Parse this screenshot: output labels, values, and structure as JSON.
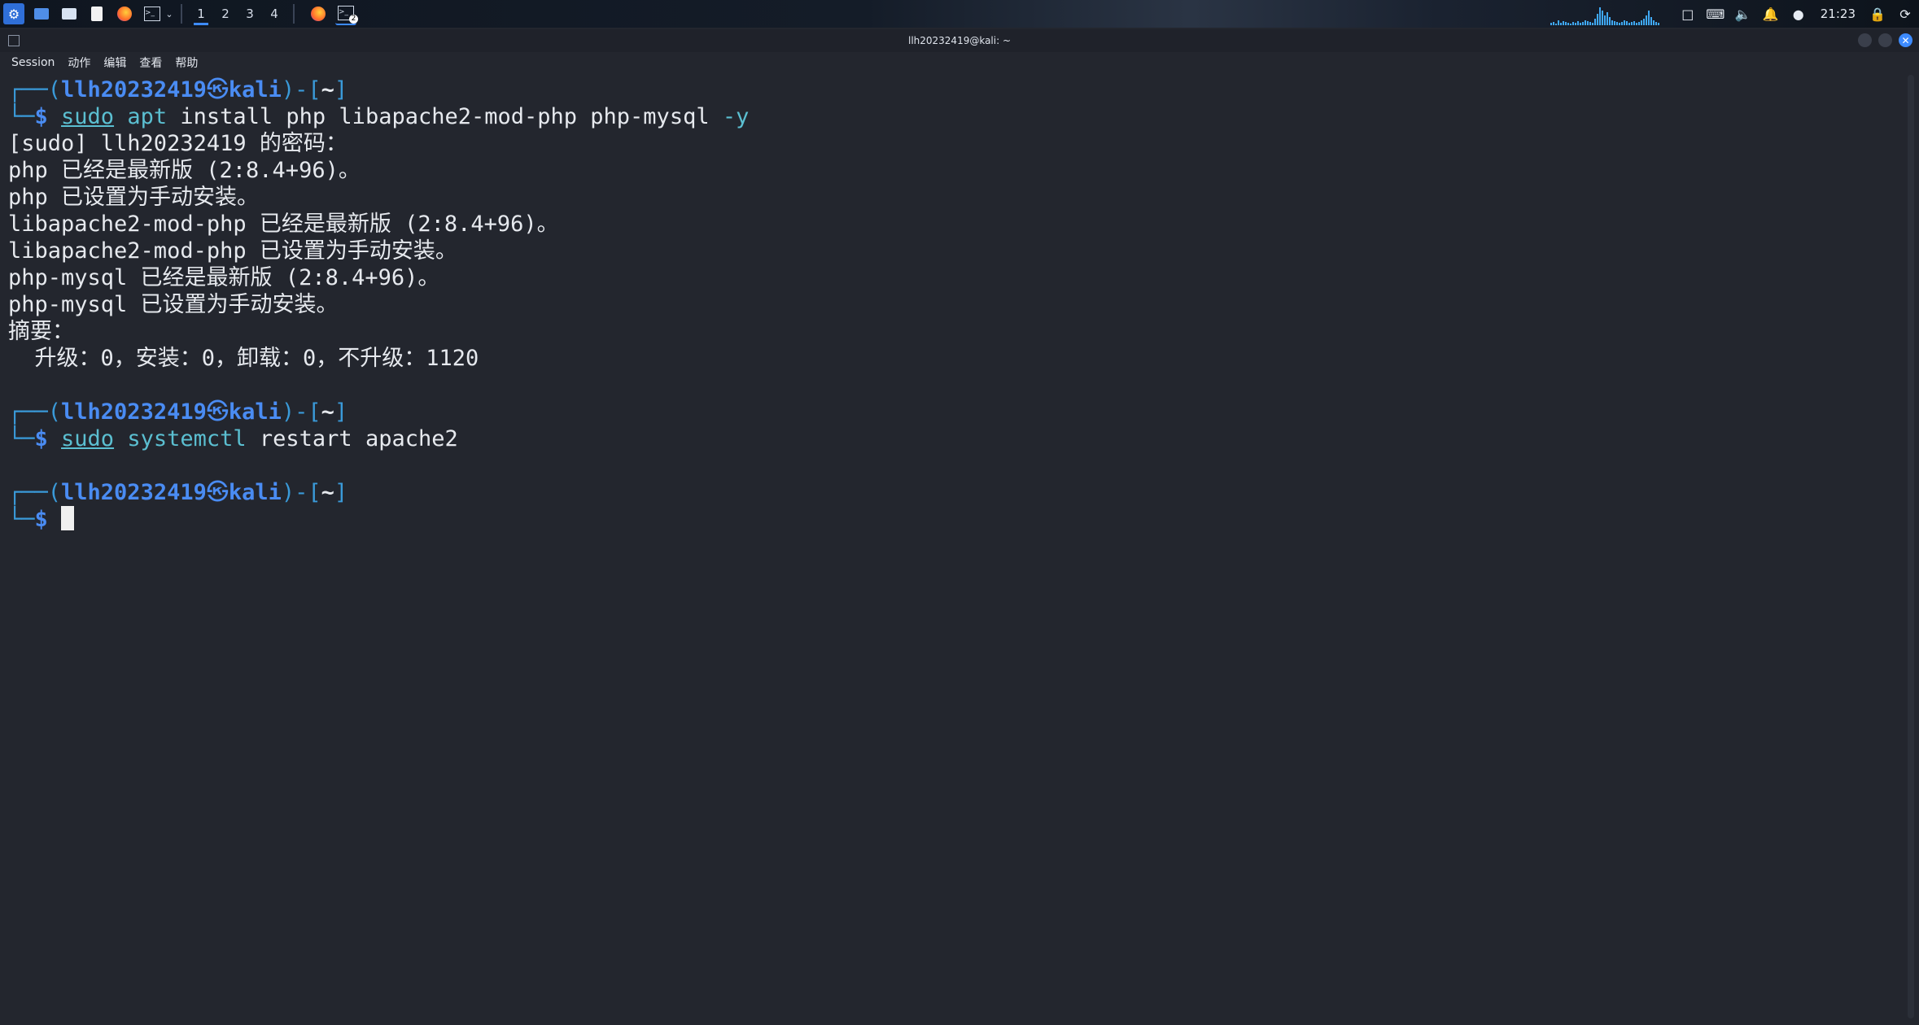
{
  "taskbar": {
    "workspaces": [
      "1",
      "2",
      "3",
      "4"
    ],
    "active_workspace": "1",
    "terminal_badge": "2",
    "clock": "21:23"
  },
  "window": {
    "title": "llh20232419@kali: ~"
  },
  "menubar": {
    "items": [
      "Session",
      "动作",
      "编辑",
      "查看",
      "帮助"
    ]
  },
  "terminal": {
    "prompt_user": "llh20232419",
    "prompt_host": "kali",
    "prompt_dir": "~",
    "cmd1": {
      "sudo": "sudo",
      "prog": "apt",
      "args": " install php libapache2-mod-php php-mysql ",
      "flag": "-y"
    },
    "output1": [
      "[sudo] llh20232419 的密码：",
      "php 已经是最新版 (2:8.4+96)。",
      "php 已设置为手动安装。",
      "libapache2-mod-php 已经是最新版 (2:8.4+96)。",
      "libapache2-mod-php 已设置为手动安装。",
      "php-mysql 已经是最新版 (2:8.4+96)。",
      "php-mysql 已设置为手动安装。",
      "摘要：",
      "  升级：0，安装：0，卸载：0，不升级：1120"
    ],
    "cmd2": {
      "sudo": "sudo",
      "prog": "systemctl",
      "args": " restart apache2"
    }
  }
}
